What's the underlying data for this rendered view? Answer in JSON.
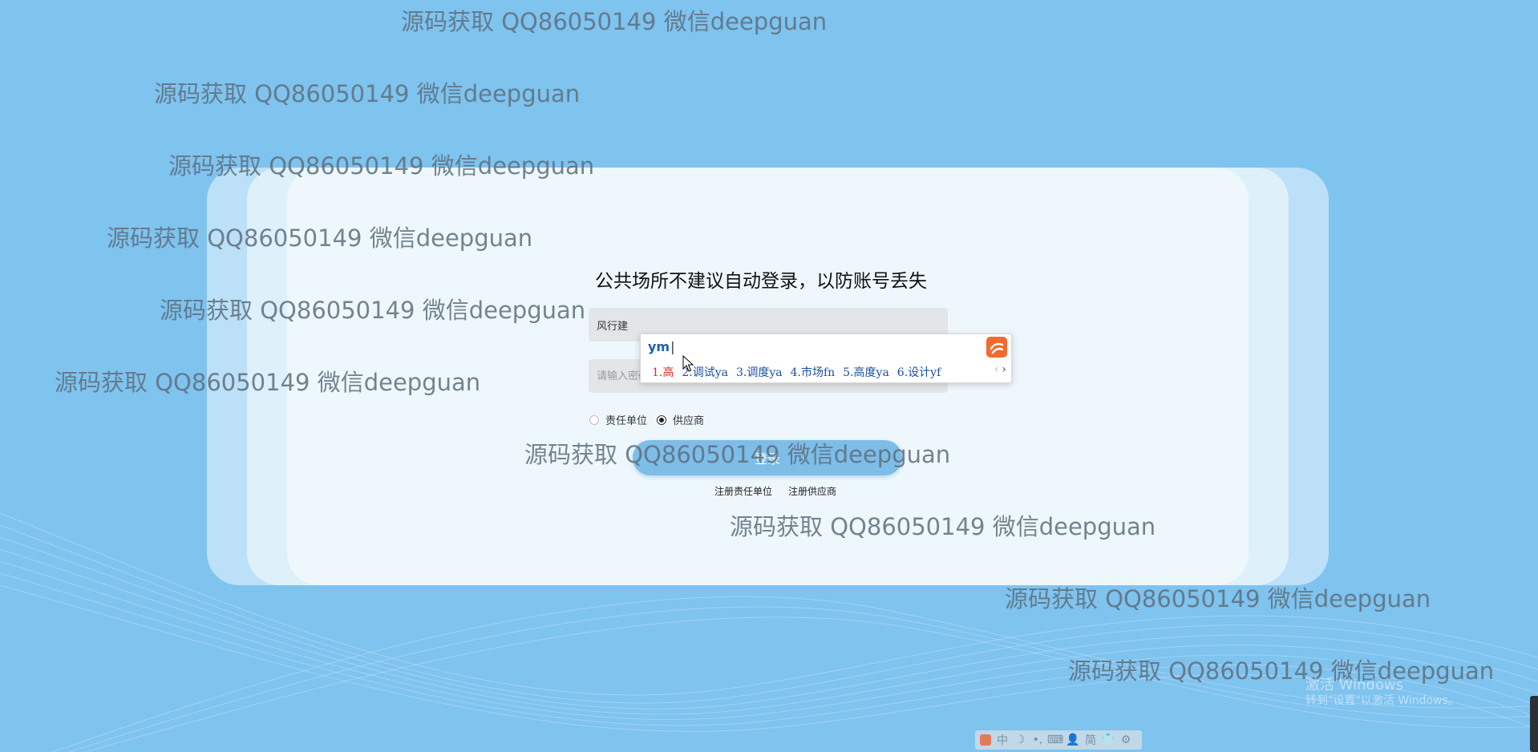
{
  "login": {
    "notice": "公共场所不建议自动登录，以防账号丢失",
    "username_value": "风行建",
    "password_placeholder": "请输入密码",
    "role_options": [
      "责任单位",
      "供应商"
    ],
    "selected_role": "供应商",
    "login_button": "登录",
    "register_links": [
      "注册责任单位",
      "注册供应商"
    ]
  },
  "ime_popup": {
    "composition": "ym",
    "candidates": [
      "1.高",
      "2.调试ya",
      "3.调度ya",
      "4.市场fn",
      "5.高度ya",
      "6.设计yf"
    ],
    "pager_prev": "‹",
    "pager_next": "›",
    "logo_icon": "sogou-logo-icon"
  },
  "watermark": "源码获取 QQ86050149 微信deepguan",
  "windows_activation": {
    "line1": "激活 Windows",
    "line2": "转到\"设置\"以激活 Windows。"
  },
  "ime_toolbar": {
    "items": [
      "中",
      "☽",
      "•,",
      "⌨",
      "👤",
      "简",
      "👕",
      "⚙"
    ]
  },
  "colors": {
    "background": "#7fc3ef",
    "button": "#7dbde8",
    "ime_accent": "#f26b2e"
  }
}
